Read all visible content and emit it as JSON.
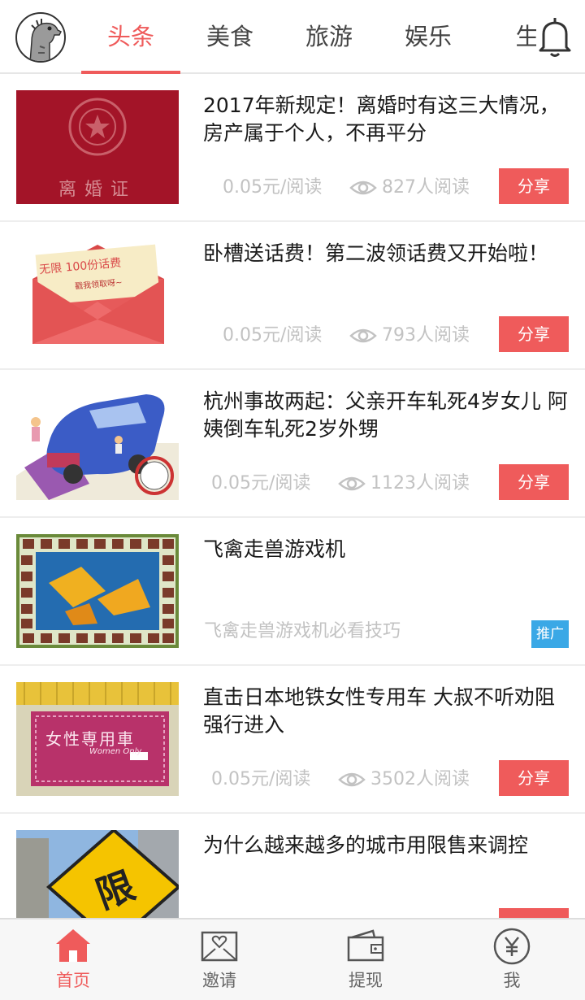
{
  "header": {
    "tabs": [
      {
        "label": "头条",
        "active": true
      },
      {
        "label": "美食",
        "active": false
      },
      {
        "label": "旅游",
        "active": false
      },
      {
        "label": "娱乐",
        "active": false
      },
      {
        "label": "生",
        "active": false
      }
    ]
  },
  "feed": {
    "items": [
      {
        "title": "2017年新规定！离婚时有这三大情况，房产属于个人，不再平分",
        "rate": "0.05元/阅读",
        "reads": "827人阅读",
        "action": "分享",
        "thumb_text": "离婚证"
      },
      {
        "title": "卧槽送话费！第二波领话费又开始啦！",
        "rate": "0.05元/阅读",
        "reads": "793人阅读",
        "action": "分享",
        "thumb_text": "无限 100份话费",
        "thumb_text2": "戳我领取呀~"
      },
      {
        "title": "杭州事故两起：父亲开车轧死4岁女儿 阿姨倒车轧死2岁外甥",
        "rate": "0.05元/阅读",
        "reads": "1123人阅读",
        "action": "分享"
      },
      {
        "title": "飞禽走兽游戏机",
        "subtitle": "飞禽走兽游戏机必看技巧",
        "badge": "推广"
      },
      {
        "title": "直击日本地铁女性专用车 大叔不听劝阻强行进入",
        "rate": "0.05元/阅读",
        "reads": "3502人阅读",
        "action": "分享",
        "thumb_text": "女性専用車",
        "thumb_text2": "Women Only"
      },
      {
        "title": "为什么越来越多的城市用限售来调控",
        "thumb_text": "限"
      }
    ]
  },
  "bottom_nav": {
    "items": [
      {
        "label": "首页",
        "active": true
      },
      {
        "label": "邀请",
        "active": false
      },
      {
        "label": "提现",
        "active": false
      },
      {
        "label": "我",
        "active": false
      }
    ]
  },
  "colors": {
    "accent": "#ef5b5b",
    "ad_badge": "#3aa8e6",
    "meta_text": "#c2c2c2"
  }
}
